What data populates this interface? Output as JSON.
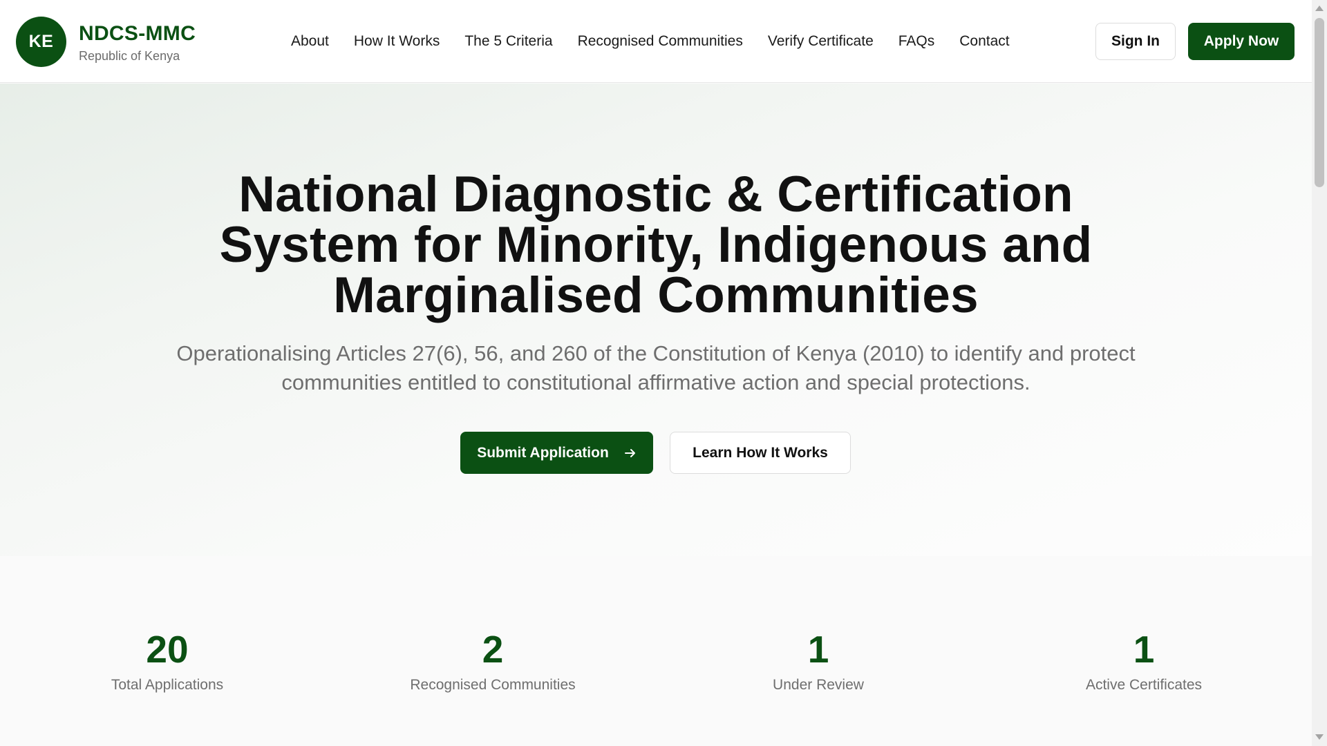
{
  "header": {
    "logo_text": "KE",
    "brand_title": "NDCS-MMC",
    "brand_subtitle": "Republic of Kenya",
    "nav": [
      "About",
      "How It Works",
      "The 5 Criteria",
      "Recognised Communities",
      "Verify Certificate",
      "FAQs",
      "Contact"
    ],
    "sign_in_label": "Sign In",
    "apply_label": "Apply Now"
  },
  "hero": {
    "title_lines": [
      "National Diagnostic & Certification",
      "System for Minority, Indigenous and",
      "Marginalised Communities"
    ],
    "subtitle": "Operationalising Articles 27(6), 56, and 260 of the Constitution of Kenya (2010) to identify and protect communities entitled to constitutional affirmative action and special protections.",
    "primary_cta": "Submit Application",
    "primary_cta_icon": "arrow-right-icon",
    "secondary_cta": "Learn How It Works"
  },
  "stats": [
    {
      "value": "20",
      "label": "Total Applications"
    },
    {
      "value": "2",
      "label": "Recognised Communities"
    },
    {
      "value": "1",
      "label": "Under Review"
    },
    {
      "value": "1",
      "label": "Active Certificates"
    }
  ],
  "colors": {
    "brand_green": "#0b5013",
    "muted_text": "#6e6e6e",
    "body_text": "#111111"
  }
}
